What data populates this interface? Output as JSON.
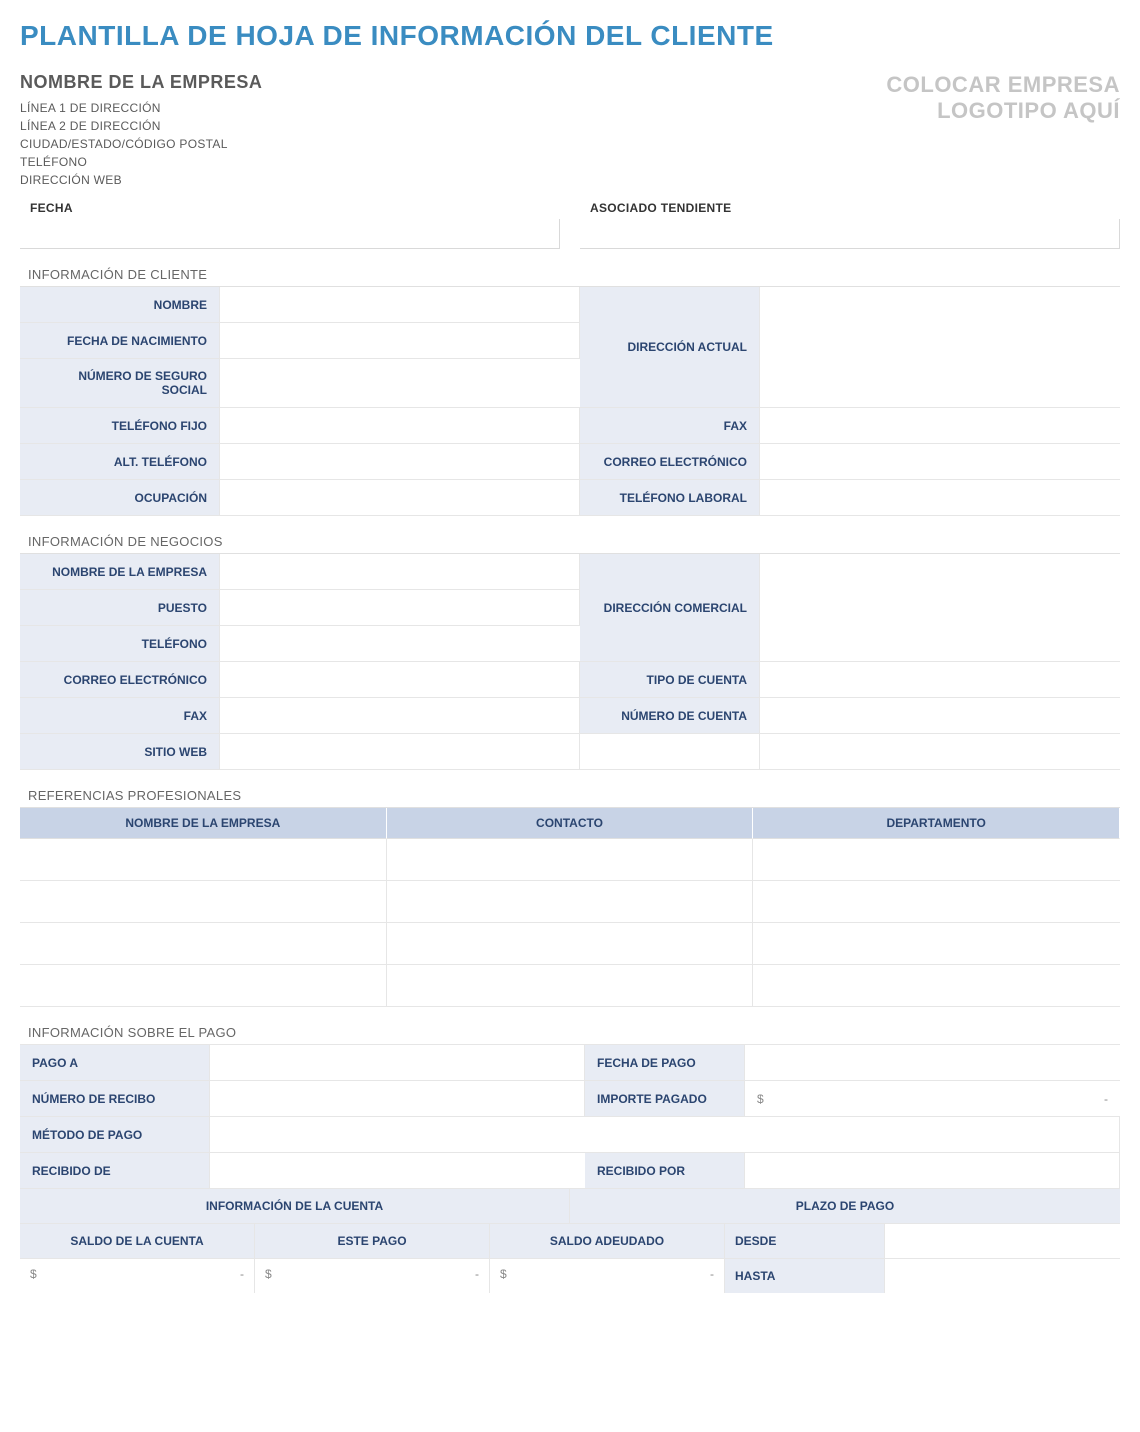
{
  "title": "PLANTILLA DE HOJA DE INFORMACIÓN DEL CLIENTE",
  "company": {
    "name": "NOMBRE DE LA EMPRESA",
    "line1": "LÍNEA 1 DE DIRECCIÓN",
    "line2": "LÍNEA 2 DE DIRECCIÓN",
    "city_state_zip": "CIUDAD/ESTADO/CÓDIGO POSTAL",
    "phone": "TELÉFONO",
    "web": "DIRECCIÓN WEB"
  },
  "logo": {
    "line1": "COLOCAR EMPRESA",
    "line2": "LOGOTIPO AQUÍ"
  },
  "top_fields": {
    "date_label": "FECHA",
    "date_value": "",
    "associate_label": "ASOCIADO TENDIENTE",
    "associate_value": ""
  },
  "sections": {
    "client_info": "INFORMACIÓN DE CLIENTE",
    "business_info": "INFORMACIÓN DE NEGOCIOS",
    "references": "REFERENCIAS PROFESIONALES",
    "payment_info": "INFORMACIÓN SOBRE EL PAGO"
  },
  "client": {
    "name_label": "NOMBRE",
    "name_value": "",
    "dob_label": "FECHA DE NACIMIENTO",
    "dob_value": "",
    "ssn_label": "NÚMERO DE SEGURO SOCIAL",
    "ssn_value": "",
    "address_label": "DIRECCIÓN ACTUAL",
    "address_value": "",
    "landline_label": "TELÉFONO FIJO",
    "landline_value": "",
    "fax_label": "FAX",
    "fax_value": "",
    "alt_phone_label": "ALT. TELÉFONO",
    "alt_phone_value": "",
    "email_label": "CORREO ELECTRÓNICO",
    "email_value": "",
    "occupation_label": "OCUPACIÓN",
    "occupation_value": "",
    "work_phone_label": "TELÉFONO LABORAL",
    "work_phone_value": ""
  },
  "business": {
    "company_name_label": "NOMBRE DE LA EMPRESA",
    "company_name_value": "",
    "position_label": "PUESTO",
    "position_value": "",
    "phone_label": "TELÉFONO",
    "phone_value": "",
    "address_label": "DIRECCIÓN COMERCIAL",
    "address_value": "",
    "email_label": "CORREO ELECTRÓNICO",
    "email_value": "",
    "account_type_label": "TIPO DE CUENTA",
    "account_type_value": "",
    "fax_label": "FAX",
    "fax_value": "",
    "account_number_label": "NÚMERO DE CUENTA",
    "account_number_value": "",
    "website_label": "SITIO WEB",
    "website_value": ""
  },
  "references_table": {
    "headers": {
      "company": "NOMBRE DE LA EMPRESA",
      "contact": "CONTACTO",
      "department": "DEPARTAMENTO"
    }
  },
  "payment": {
    "pay_to_label": "PAGO A",
    "pay_to_value": "",
    "pay_date_label": "FECHA DE PAGO",
    "pay_date_value": "",
    "receipt_no_label": "NÚMERO DE RECIBO",
    "receipt_no_value": "",
    "amount_paid_label": "IMPORTE PAGADO",
    "amount_paid_prefix": "$",
    "amount_paid_suffix": "-",
    "method_label": "MÉTODO DE PAGO",
    "method_value": "",
    "received_from_label": "RECIBIDO DE",
    "received_from_value": "",
    "received_by_label": "RECIBIDO POR",
    "received_by_value": "",
    "account_info_header": "INFORMACIÓN DE LA CUENTA",
    "payment_term_header": "PLAZO DE PAGO",
    "balance_label": "SALDO DE LA CUENTA",
    "this_payment_label": "ESTE PAGO",
    "owed_label": "SALDO ADEUDADO",
    "from_label": "DESDE",
    "from_value": "",
    "to_label": "HASTA",
    "to_value": "",
    "money_prefix": "$",
    "money_suffix": "-"
  }
}
